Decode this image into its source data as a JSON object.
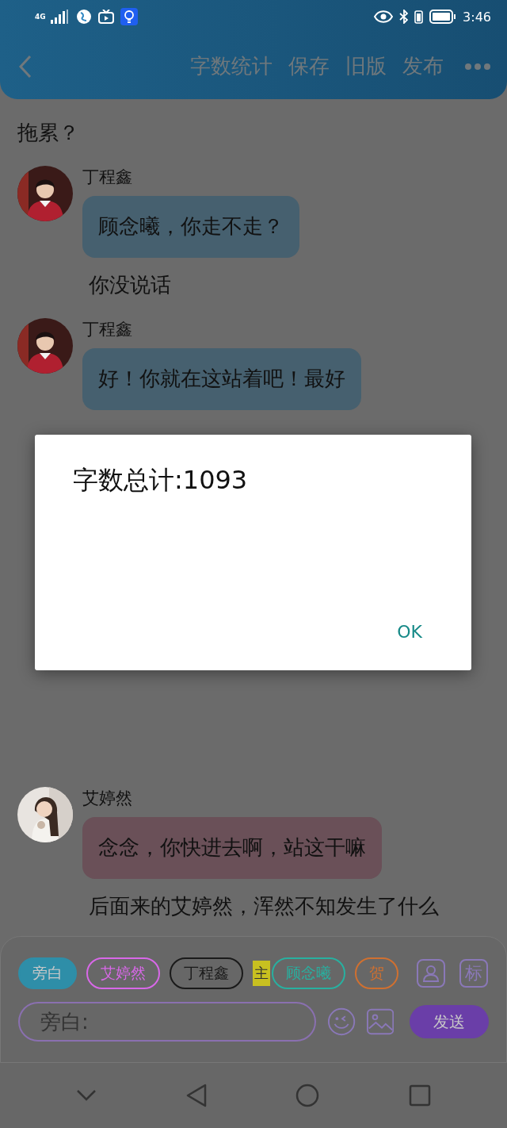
{
  "status_bar": {
    "network": "4G",
    "time": "3:46"
  },
  "header": {
    "actions": [
      "字数统计",
      "保存",
      "旧版",
      "发布"
    ]
  },
  "messages": [
    {
      "kind": "narration-tail",
      "text": "拖累？"
    },
    {
      "kind": "chat",
      "name": "丁程鑫",
      "text": "顾念曦，你走不走？",
      "color": "#46606f"
    },
    {
      "kind": "narration",
      "text": "你没说话"
    },
    {
      "kind": "chat",
      "name": "丁程鑫",
      "text": "好！你就在这站着吧！最好",
      "color": "#46606f"
    },
    {
      "kind": "chat",
      "name": "艾婷然",
      "text": "念念，你快进去啊，站这干嘛",
      "color": "#6a5058"
    },
    {
      "kind": "narration",
      "text": "后面来的艾婷然，浑然不知发生了什么"
    }
  ],
  "composer": {
    "roles": [
      {
        "label": "旁白",
        "color": "#2e8ea8",
        "selected": true
      },
      {
        "label": "艾婷然",
        "color": "#d868e8",
        "selected": false
      },
      {
        "label": "丁程鑫",
        "color": "#1a1a1a",
        "selected": false
      },
      {
        "label": "顾念曦",
        "color": "#28b0a0",
        "selected": false,
        "badge": "主"
      },
      {
        "label": "贺",
        "color": "#d07030",
        "selected": false
      }
    ],
    "tag_button": "标",
    "placeholder": "旁白:",
    "send": "发送"
  },
  "dialog": {
    "message": "字数总计:1093",
    "button": "OK"
  }
}
